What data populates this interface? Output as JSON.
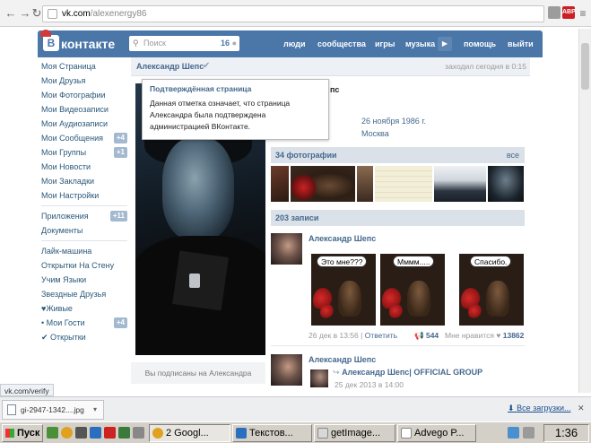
{
  "browser": {
    "url_host": "vk.com",
    "url_path": "/alexenergy86",
    "back_icon": "back-arrow-icon",
    "forward_icon": "forward-arrow-icon",
    "reload_icon": "reload-icon",
    "ext_abp": "ABP"
  },
  "header": {
    "logo_letter": "В",
    "logo_text": "контакте",
    "search_placeholder": "Поиск",
    "search_count": "16",
    "nav": [
      "люди",
      "сообщества",
      "игры",
      "музыка",
      "помощь",
      "выйти"
    ],
    "play_icon": "▶"
  },
  "menu": {
    "items": [
      {
        "label": "Моя Страница"
      },
      {
        "label": "Мои Друзья"
      },
      {
        "label": "Мои Фотографии"
      },
      {
        "label": "Мои Видеозаписи"
      },
      {
        "label": "Мои Аудиозаписи"
      },
      {
        "label": "Мои Сообщения",
        "count": "+4"
      },
      {
        "label": "Мои Группы",
        "count": "+1"
      },
      {
        "label": "Мои Новости"
      },
      {
        "label": "Мои Закладки"
      },
      {
        "label": "Мои Настройки"
      }
    ],
    "apps": [
      {
        "label": "Приложения",
        "count": "+11"
      },
      {
        "label": "Документы"
      }
    ],
    "extra": [
      {
        "label": "Лайк-машина"
      },
      {
        "label": "Открытки На Стену"
      },
      {
        "label": "Учим Языки"
      },
      {
        "label": "Звездные Друзья"
      },
      {
        "label": "♥Живые"
      },
      {
        "label": "• Мои Гости",
        "count": "+4"
      },
      {
        "label": "✔ Открытки"
      }
    ]
  },
  "profile": {
    "name": "Александр Шепс",
    "last_seen": "заходил сегодня в 0:15",
    "tooltip_title": "Подтверждённая страница",
    "tooltip_body": "Данная отметка означает, что страница Александра была подтверждена администрацией ВКонтакте.",
    "name_behind": "пс",
    "birthday": "26 ноября 1986 г.",
    "city": "Москва",
    "subscribed": "Вы подписаны на Александра"
  },
  "photos": {
    "header": "34 фотографии",
    "all_link": "все"
  },
  "wall": {
    "header": "203 записи",
    "post1": {
      "author": "Александр Шепс",
      "bubbles": [
        "Это мне???",
        "Мммм.....",
        "Спасибо."
      ],
      "date": "26 дек в 13:56",
      "reply": "Ответить",
      "reposts": "544",
      "likes_label": "Мне нравится",
      "likes": "13862"
    },
    "post2": {
      "author": "Александр Шепс",
      "group": "Александр Шепс| OFFICIAL GROUP",
      "date": "25 дек 2013 в 14:00"
    }
  },
  "status_url": "vk.com/verify",
  "downloads": {
    "file": "gi-2947-1342....jpg",
    "all_link": "Все загрузки..."
  },
  "taskbar": {
    "start": "Пуск",
    "tasks": [
      "2 Googl...",
      "Текстов...",
      "getImage...",
      "Advego P..."
    ],
    "clock": "1:36"
  },
  "colors": {
    "vk_blue": "#4a76a8",
    "link": "#45688e"
  }
}
